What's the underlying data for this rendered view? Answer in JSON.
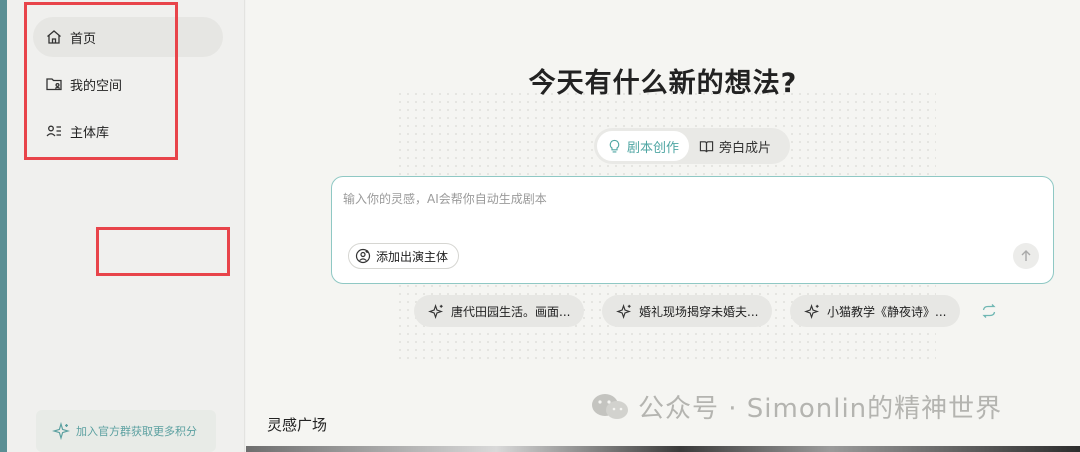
{
  "sidebar": {
    "items": [
      {
        "label": "首页",
        "icon": "home-icon",
        "active": true
      },
      {
        "label": "我的空间",
        "icon": "folder-user-icon",
        "active": false
      },
      {
        "label": "主体库",
        "icon": "user-list-icon",
        "active": false
      }
    ],
    "promo_label": "加入官方群获取更多积分"
  },
  "main": {
    "headline": "今天有什么新的想法?",
    "tabs": [
      {
        "label": "剧本创作",
        "icon": "lightbulb-icon",
        "active": true
      },
      {
        "label": "旁白成片",
        "icon": "book-icon",
        "active": false
      }
    ],
    "input": {
      "placeholder": "输入你的灵感，AI会帮你自动生成剧本",
      "add_cast_label": "添加出演主体"
    },
    "suggestions": [
      "唐代田园生活。画面...",
      "婚礼现场揭穿未婚夫...",
      "小猫教学《静夜诗》..."
    ],
    "section_title": "灵感广场",
    "watermark": "公众号 · Simonlin的精神世界"
  },
  "colors": {
    "accent": "#4fa6a3",
    "highlight": "#e8444a",
    "left_strip": "#5b8f94"
  }
}
